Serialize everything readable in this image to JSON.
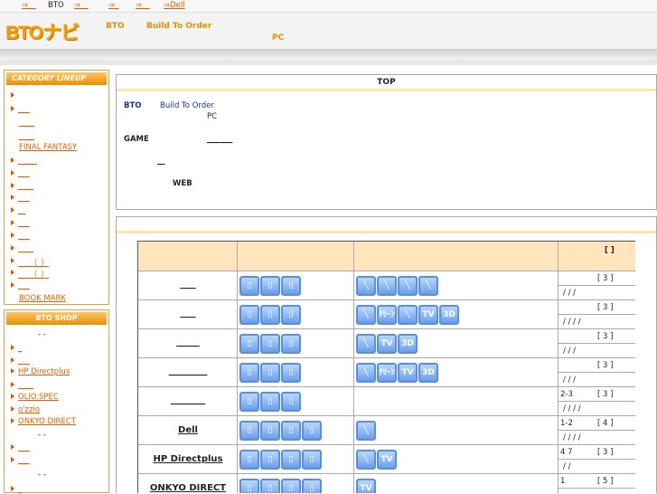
{
  "topbar": {
    "links": [
      "⇒__",
      "BTO",
      "⇒__",
      "⇒_",
      "⇒__",
      "⇒Dell"
    ]
  },
  "header": {
    "logo": "BTOナビ",
    "label1": "BTO",
    "label2": "Build To Order",
    "label3": "PC"
  },
  "sidebar": {
    "category_title": "CATEGORY LINEUP",
    "category_items": [
      "",
      "___",
      "____",
      "____",
      "FINAL FANTASY",
      "_____",
      "___",
      "____",
      "___",
      "__",
      "___",
      "___",
      "____",
      "___（_）",
      "___（_）",
      "___",
      "BOOK MARK"
    ],
    "shop_title": "BTO SHOP",
    "shop_items": [
      "- -",
      "_",
      "___",
      "HP Directplus",
      "____",
      "OLIO.SPEC",
      "o'zzio",
      "ONKYO DIRECT",
      "- -",
      "___",
      "___",
      "- -",
      "_"
    ]
  },
  "intro": {
    "title": "TOP",
    "bto": "BTO",
    "bto_desc": "Build To Order",
    "pc": "PC",
    "game": "GAME",
    "game_link": "___ ___",
    "link2": "__",
    "web": "WEB"
  },
  "table": {
    "header_label": "[ ]",
    "rows": [
      {
        "name": "____",
        "rating": "[ 3 ]",
        "sub": "/ / /",
        "features": [
          "",
          "",
          "",
          ""
        ],
        "icons": 3,
        "range": ""
      },
      {
        "name": "____",
        "rating": "[ 3 ]",
        "sub": "/ / / /",
        "features": [
          "",
          "ｸﾘｰﾝ",
          "",
          "TV",
          "3D"
        ],
        "icons": 3,
        "range": ""
      },
      {
        "name": "______",
        "rating": "[ 3 ]",
        "sub": "/ / /",
        "features": [
          "",
          "TV",
          "3D"
        ],
        "icons": 3,
        "range": ""
      },
      {
        "name": "__________",
        "rating": "[ 3 ]",
        "sub": "/ / /",
        "features": [
          "",
          "ｸﾘｰﾝ",
          "TV",
          "3D"
        ],
        "icons": 3,
        "range": ""
      },
      {
        "name": "_________",
        "rating": "[ 3 ]",
        "sub": "/ / / /",
        "features": [],
        "icons": 3,
        "range": "2-3"
      },
      {
        "name": "Dell",
        "rating": "[ 4 ]",
        "sub": "/ / / /",
        "features": [
          ""
        ],
        "icons": 4,
        "range": "1-2"
      },
      {
        "name": "HP Directplus",
        "rating": "[ 3 ]",
        "sub": "/ /",
        "features": [
          "",
          "TV"
        ],
        "icons": 4,
        "range": "4 7"
      },
      {
        "name": "ONKYO DIRECT",
        "rating": "[ 5 ]",
        "sub": "",
        "features": [
          "TV"
        ],
        "icons": 4,
        "range": "1"
      }
    ]
  }
}
